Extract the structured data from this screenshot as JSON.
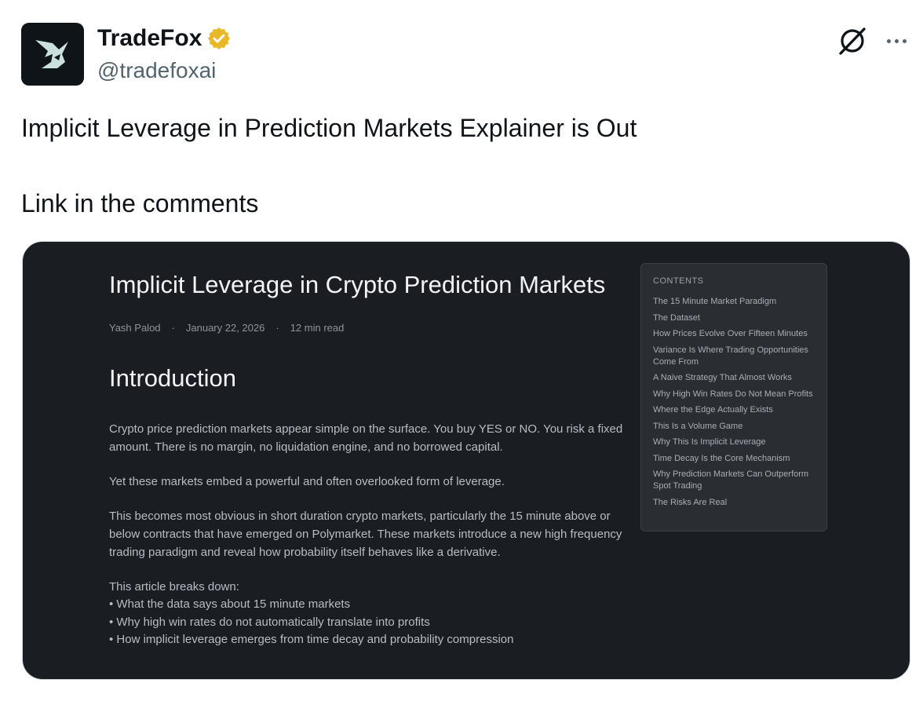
{
  "author": {
    "name": "TradeFox",
    "handle": "@tradefoxai",
    "verified_color": "#e8b829"
  },
  "tweet": {
    "lines": [
      "Implicit Leverage in Prediction Markets Explainer is Out",
      "Link in the comments"
    ]
  },
  "icons": {
    "grok": "grok-icon",
    "more": "more-icon",
    "verified": "verified-badge-icon"
  },
  "article": {
    "title": "Implicit Leverage in Crypto Prediction Markets",
    "author": "Yash Palod",
    "separator": "·",
    "date": "January 22, 2026",
    "read_time": "12 min read",
    "section_heading": "Introduction",
    "paragraphs": [
      "Crypto price prediction markets appear simple on the surface. You buy YES or NO. You risk a fixed amount. There is no margin, no liquidation engine, and no borrowed capital.",
      "Yet these markets embed a powerful and often overlooked form of leverage.",
      "This becomes most obvious in short duration crypto markets, particularly the 15 minute above or below contracts that have emerged on Polymarket. These markets introduce a new high frequency trading paradigm and reveal how probability itself behaves like a derivative.",
      "This article breaks down:"
    ],
    "bullets": [
      "What the data says about 15 minute markets",
      "Why high win rates do not automatically translate into profits",
      "How implicit leverage emerges from time decay and probability compression"
    ]
  },
  "toc": {
    "heading": "CONTENTS",
    "items": [
      "The 15 Minute Market Paradigm",
      "The Dataset",
      "How Prices Evolve Over Fifteen Minutes",
      "Variance Is Where Trading Opportunities Come From",
      "A Naive Strategy That Almost Works",
      "Why High Win Rates Do Not Mean Profits",
      "Where the Edge Actually Exists",
      "This Is a Volume Game",
      "Why This Is Implicit Leverage",
      "Time Decay Is the Core Mechanism",
      "Why Prediction Markets Can Outperform Spot Trading",
      "The Risks Are Real"
    ]
  }
}
